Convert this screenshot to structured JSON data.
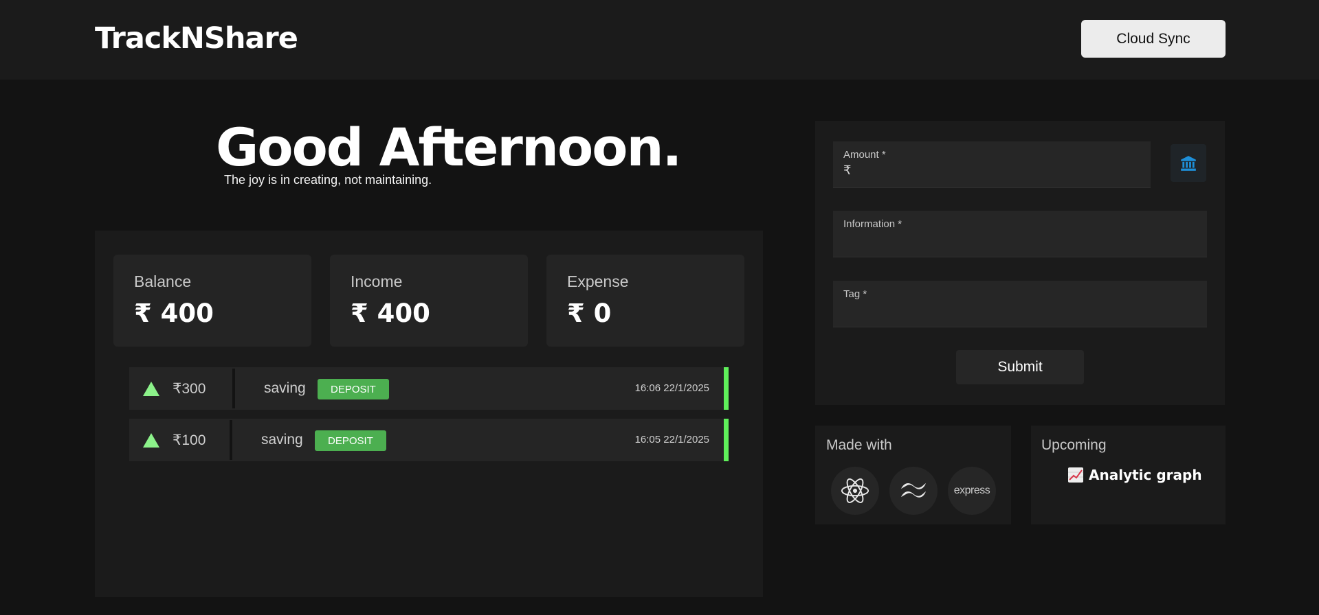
{
  "header": {
    "brand": "TrackNShare",
    "cloud_sync_label": "Cloud Sync"
  },
  "hero": {
    "greeting": "Good Afternoon.",
    "tagline": "The joy is in creating, not maintaining."
  },
  "summary": {
    "balance": {
      "label": "Balance",
      "value": "₹ 400"
    },
    "income": {
      "label": "Income",
      "value": "₹ 400"
    },
    "expense": {
      "label": "Expense",
      "value": "₹ 0"
    }
  },
  "transactions": [
    {
      "amount": "₹300",
      "info": "saving",
      "type": "DEPOSIT",
      "time": "16:06 22/1/2025"
    },
    {
      "amount": "₹100",
      "info": "saving",
      "type": "DEPOSIT",
      "time": "16:05 22/1/2025"
    }
  ],
  "form": {
    "amount_label": "Amount *",
    "amount_prefix": "₹",
    "amount_value": "",
    "information_label": "Information *",
    "information_value": "",
    "tag_label": "Tag *",
    "tag_value": "",
    "submit_label": "Submit",
    "bank_icon": "bank-icon"
  },
  "made_with": {
    "title": "Made with",
    "tech": [
      {
        "icon": "react-icon"
      },
      {
        "icon": "tailwind-icon"
      },
      {
        "icon": "express-icon",
        "text": "express"
      }
    ]
  },
  "upcoming": {
    "title": "Upcoming",
    "item": "Analytic graph",
    "item_icon": "chart-increasing-icon"
  },
  "colors": {
    "accent_green": "#4caf50",
    "deposit_bar": "#5ff05a",
    "bank_icon_blue": "#1e8fd8",
    "background": "#131313"
  }
}
